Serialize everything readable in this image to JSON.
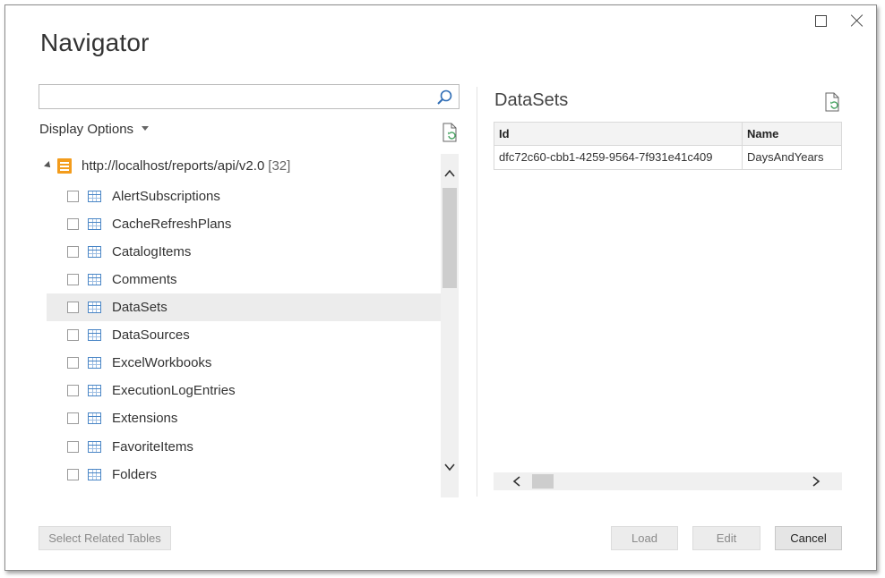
{
  "window": {
    "title": "Navigator",
    "maximize_icon": "maximize-icon",
    "close_icon": "close-icon"
  },
  "search": {
    "value": "",
    "placeholder": "",
    "icon": "search-icon"
  },
  "display_options": {
    "label": "Display Options",
    "icon": "caret-down-icon"
  },
  "tree": {
    "root": {
      "label": "http://localhost/reports/api/v2.0",
      "count": "[32]",
      "icon": "database-icon"
    },
    "items": [
      {
        "label": "AlertSubscriptions",
        "checked": false
      },
      {
        "label": "CacheRefreshPlans",
        "checked": false
      },
      {
        "label": "CatalogItems",
        "checked": false
      },
      {
        "label": "Comments",
        "checked": false
      },
      {
        "label": "DataSets",
        "checked": false,
        "selected": true
      },
      {
        "label": "DataSources",
        "checked": false
      },
      {
        "label": "ExcelWorkbooks",
        "checked": false
      },
      {
        "label": "ExecutionLogEntries",
        "checked": false
      },
      {
        "label": "Extensions",
        "checked": false
      },
      {
        "label": "FavoriteItems",
        "checked": false
      },
      {
        "label": "Folders",
        "checked": false
      }
    ]
  },
  "preview": {
    "title": "DataSets",
    "columns": [
      "Id",
      "Name"
    ],
    "rows": [
      [
        "dfc72c60-cbb1-4259-9564-7f931e41c409",
        "DaysAndYears"
      ]
    ]
  },
  "buttons": {
    "select_related": "Select Related Tables",
    "load": "Load",
    "edit": "Edit",
    "cancel": "Cancel"
  },
  "colors": {
    "database_icon": "#f39c1c",
    "table_icon": "#4a86c6",
    "refresh_icon": "#4aa564",
    "selected_row": "#ececec"
  }
}
